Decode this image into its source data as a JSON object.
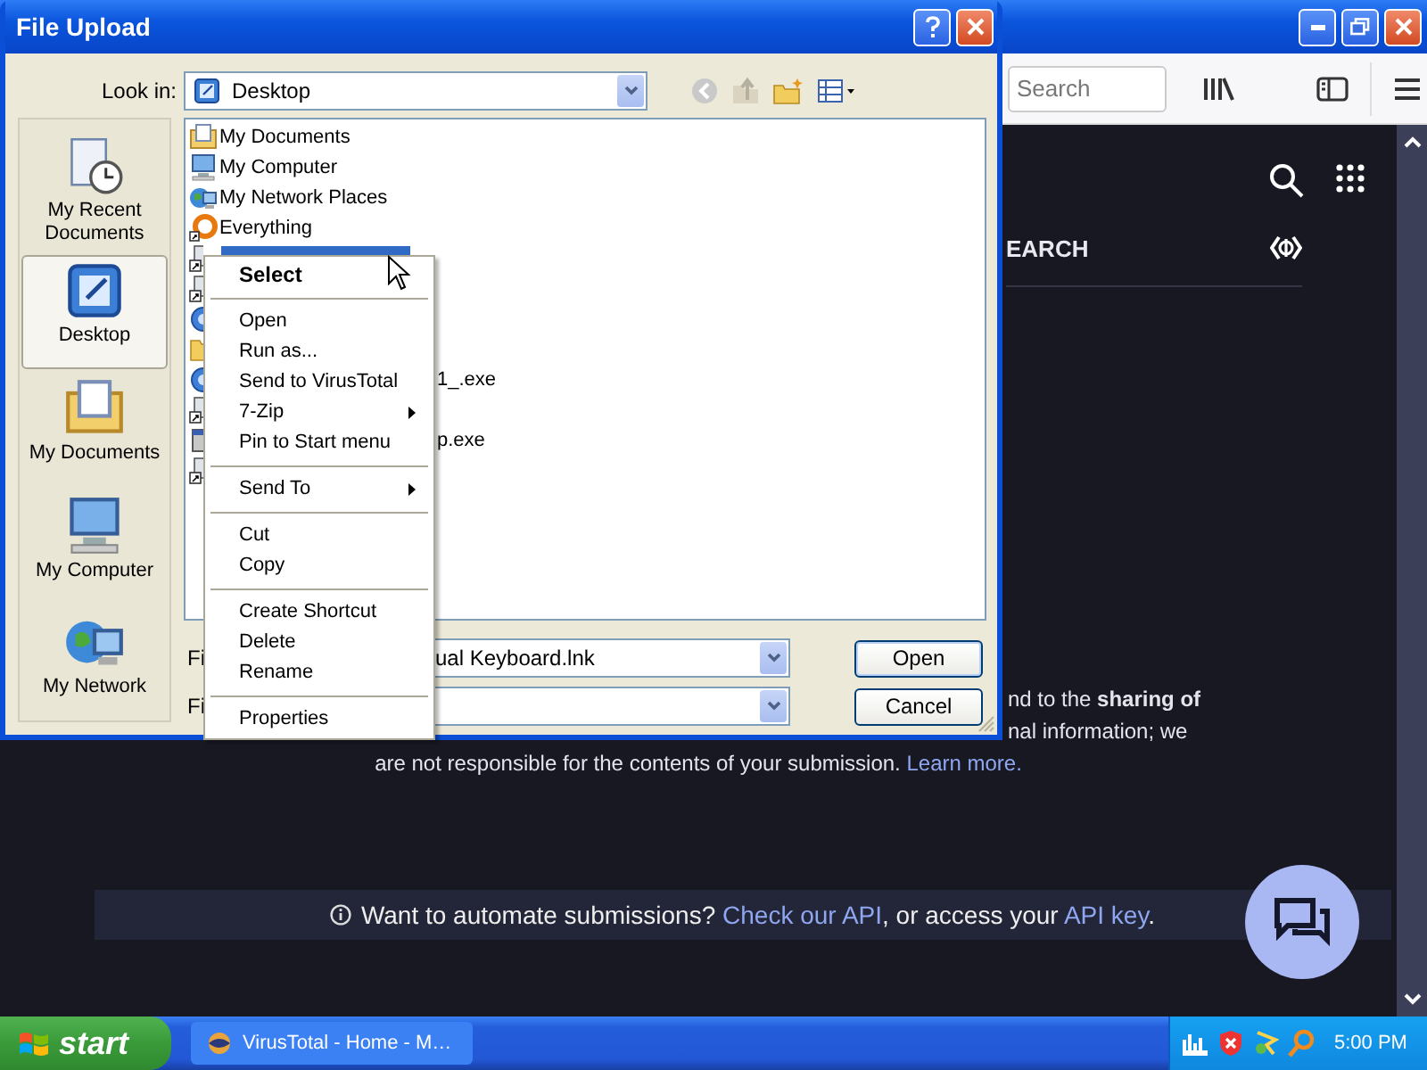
{
  "browser": {
    "search_placeholder": "Search",
    "tab_label": "EARCH",
    "notice_lines": [
      "nd to the **sharing of**",
      "nal information; we"
    ],
    "notice_last": {
      "text": "are not responsible for the contents of your submission.",
      "link": "Learn more."
    },
    "banner": {
      "text": "Want to automate submissions?",
      "link1": "Check our API",
      "middle": ", or access your",
      "link2": "API key",
      "end": "."
    }
  },
  "dialog": {
    "title": "File Upload",
    "look_in_label": "Look in:",
    "look_in_value": "Desktop",
    "places": [
      {
        "label": "My Recent Documents",
        "kind": "recent",
        "selected": false
      },
      {
        "label": "Desktop",
        "kind": "desktop",
        "selected": true
      },
      {
        "label": "My Documents",
        "kind": "documents",
        "selected": false
      },
      {
        "label": "My Computer",
        "kind": "computer",
        "selected": false
      },
      {
        "label": "My Network",
        "kind": "network",
        "selected": false
      }
    ],
    "files": [
      {
        "label": "My Documents",
        "kind": "documents",
        "selected": false
      },
      {
        "label": "My Computer",
        "kind": "computer",
        "selected": false
      },
      {
        "label": "My Network Places",
        "kind": "network",
        "selected": false
      },
      {
        "label": "Everything",
        "kind": "app",
        "selected": false
      },
      {
        "kind": "shortcut",
        "selected": true
      },
      {
        "kind": "shortcut",
        "selected": false
      },
      {
        "kind": "exe",
        "selected": false
      },
      {
        "kind": "folder",
        "selected": false
      },
      {
        "label_tail": "1_.exe",
        "kind": "exe",
        "selected": false
      },
      {
        "kind": "shortcut",
        "selected": false
      },
      {
        "label_tail": "p.exe",
        "kind": "program",
        "selected": false
      },
      {
        "kind": "shortcut",
        "selected": false
      }
    ],
    "file_name": {
      "label": "Fi",
      "value": "ual Keyboard.lnk"
    },
    "file_type": {
      "label": "Fi"
    },
    "buttons": [
      "Open",
      "Cancel"
    ]
  },
  "context_menu": {
    "items": [
      {
        "kind": "item",
        "label": "Select",
        "default": true,
        "submenu": false
      },
      {
        "kind": "separator"
      },
      {
        "kind": "item",
        "label": "Open",
        "default": false,
        "submenu": false
      },
      {
        "kind": "item",
        "label": "Run as...",
        "default": false,
        "submenu": false
      },
      {
        "kind": "item",
        "label": "Send to VirusTotal",
        "default": false,
        "submenu": false
      },
      {
        "kind": "item",
        "label": "7-Zip",
        "default": false,
        "submenu": true
      },
      {
        "kind": "item",
        "label": "Pin to Start menu",
        "default": false,
        "submenu": false
      },
      {
        "kind": "separator"
      },
      {
        "kind": "item",
        "label": "Send To",
        "default": false,
        "submenu": true
      },
      {
        "kind": "separator"
      },
      {
        "kind": "item",
        "label": "Cut",
        "default": false,
        "submenu": false
      },
      {
        "kind": "item",
        "label": "Copy",
        "default": false,
        "submenu": false
      },
      {
        "kind": "separator"
      },
      {
        "kind": "item",
        "label": "Create Shortcut",
        "default": false,
        "submenu": false
      },
      {
        "kind": "item",
        "label": "Delete",
        "default": false,
        "submenu": false
      },
      {
        "kind": "item",
        "label": "Rename",
        "default": false,
        "submenu": false
      },
      {
        "kind": "separator"
      },
      {
        "kind": "item",
        "label": "Properties",
        "default": false,
        "submenu": false
      }
    ]
  },
  "taskbar": {
    "start": "start",
    "tasks": [
      {
        "label": "VirusTotal - Home - M…",
        "selected": false
      }
    ],
    "clock": "5:00 PM"
  }
}
